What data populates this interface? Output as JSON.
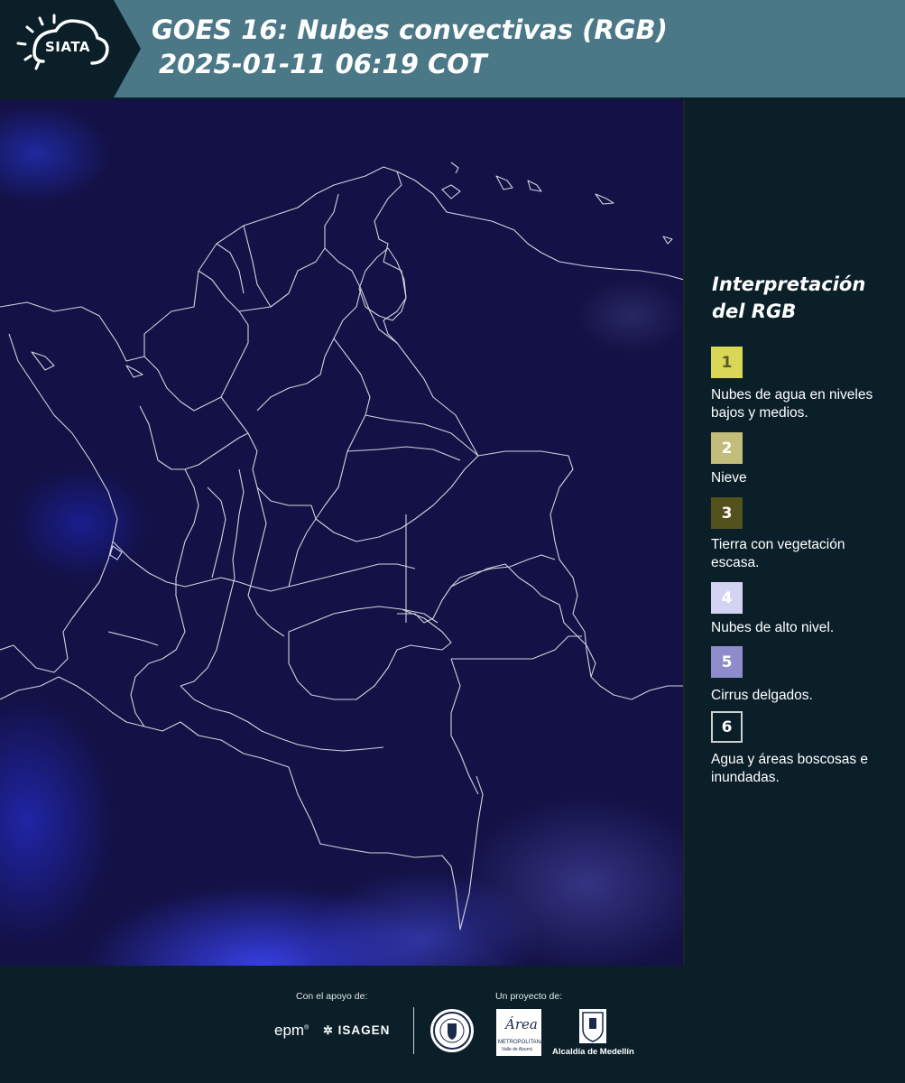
{
  "header": {
    "logo_text": "SIATA",
    "title_line1": "GOES 16: Nubes convectivas (RGB)",
    "title_line2": "2025-01-11 06:19 COT"
  },
  "legend": {
    "title_line1": "Interpretación",
    "title_line2": "del RGB",
    "items": [
      {
        "num": "1",
        "label": "Nubes de agua en niveles bajos y medios.",
        "color": "#d9d756",
        "text_color": "#5a5a2a"
      },
      {
        "num": "2",
        "label": "Nieve",
        "color": "#c2bd7a",
        "text_color": "#ffffff"
      },
      {
        "num": "3",
        "label": "Tierra con vegetación escasa.",
        "color": "#53521c",
        "text_color": "#ffffff"
      },
      {
        "num": "4",
        "label": "Nubes de alto nivel.",
        "color": "#d3d4f2",
        "text_color": "#ffffff"
      },
      {
        "num": "5",
        "label": "Cirrus delgados.",
        "color": "#8e8ccc",
        "text_color": "#ffffff"
      },
      {
        "num": "6",
        "label": "Agua y áreas boscosas e inundadas.",
        "color": "#0b1f29",
        "text_color": "#ffffff"
      }
    ]
  },
  "footer": {
    "support_caption": "Con el apoyo de:",
    "project_caption": "Un proyecto de:",
    "epm": "epm",
    "isagen": "ISAGEN",
    "metropolitana": "METROPOLITANA",
    "valle": "Valle de Aburrá",
    "area": "Área",
    "alcaldia": "Alcaldía de Medellín"
  },
  "colors": {
    "header_bg": "#4b7886",
    "page_bg": "#0b1f29",
    "map_bg": "#131145"
  }
}
